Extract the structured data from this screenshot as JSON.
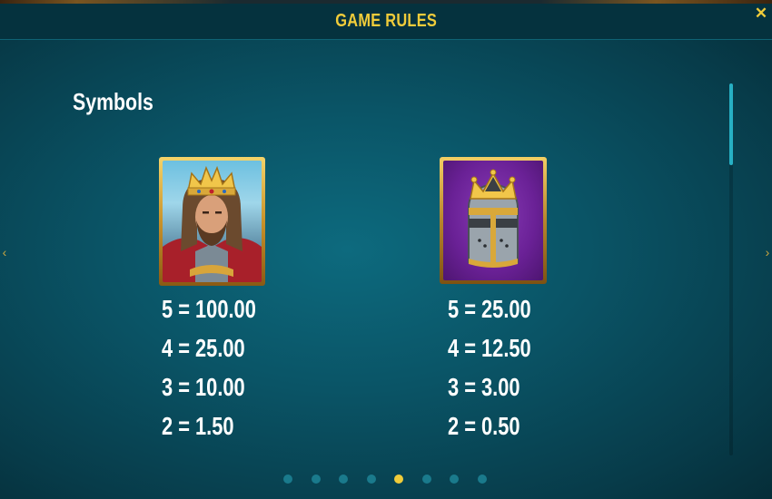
{
  "header": {
    "title": "GAME RULES",
    "close_glyph": "✕",
    "close_icon": "close-icon"
  },
  "section": {
    "title": "Symbols"
  },
  "symbols": [
    {
      "icon": "king-icon",
      "pays": [
        "5 = 100.00",
        "4 = 25.00",
        "3 = 10.00",
        "2 = 1.50"
      ]
    },
    {
      "icon": "crowned-helmet-icon",
      "pays": [
        "5 = 25.00",
        "4 = 12.50",
        "3 = 3.00",
        "2 = 0.50"
      ]
    }
  ],
  "navigation": {
    "prev_glyph": "‹",
    "next_glyph": "›"
  },
  "pagination": {
    "total_pages": 8,
    "active_page": 5
  },
  "colors": {
    "accent": "#f0cc3a",
    "background": "#0a5466",
    "header_bg": "#05323e",
    "dot_inactive": "#1a7a8c"
  }
}
